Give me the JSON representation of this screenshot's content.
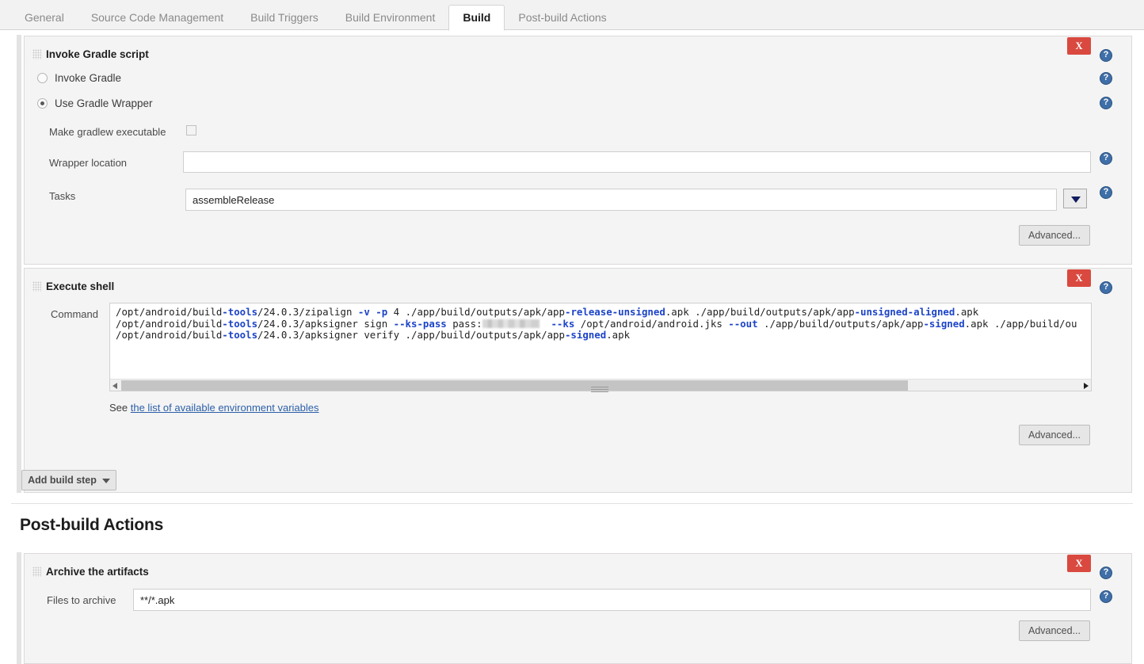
{
  "tabs": [
    {
      "label": "General",
      "active": false
    },
    {
      "label": "Source Code Management",
      "active": false
    },
    {
      "label": "Build Triggers",
      "active": false
    },
    {
      "label": "Build Environment",
      "active": false
    },
    {
      "label": "Build",
      "active": true
    },
    {
      "label": "Post-build Actions",
      "active": false
    }
  ],
  "colors": {
    "accent_blue": "#3f6fa8",
    "delete_red": "#d9493f",
    "link_blue": "#2b5fa8",
    "code_keyword": "#1d44c8",
    "panel_bg": "#f4f4f4",
    "page_bg": "#ffffff"
  },
  "icons": {
    "drag_grip": "drag-grip-icon",
    "help": "help-question-icon",
    "delete": "delete-x-icon",
    "dropdown_caret": "chevron-down-icon",
    "scroll_left": "scroll-arrow-left-icon",
    "scroll_right": "scroll-arrow-right-icon"
  },
  "gradle_step": {
    "title": "Invoke Gradle script",
    "delete_label": "X",
    "radios": [
      {
        "label": "Invoke Gradle",
        "checked": false
      },
      {
        "label": "Use Gradle Wrapper",
        "checked": true
      }
    ],
    "make_executable_label": "Make gradlew executable",
    "make_executable_checked": false,
    "wrapper_location_label": "Wrapper location",
    "wrapper_location_value": "",
    "tasks_label": "Tasks",
    "tasks_value": "assembleRelease",
    "advanced_label": "Advanced..."
  },
  "shell_step": {
    "title": "Execute shell",
    "delete_label": "X",
    "command_label": "Command",
    "command_lines": [
      [
        {
          "t": "/opt/android/build",
          "k": false
        },
        {
          "t": "-tools",
          "k": true
        },
        {
          "t": "/24.0.3/zipalign ",
          "k": false
        },
        {
          "t": "-v",
          "k": true
        },
        {
          "t": " ",
          "k": false
        },
        {
          "t": "-p",
          "k": true
        },
        {
          "t": " 4 ./app/build/outputs/apk/app",
          "k": false
        },
        {
          "t": "-release-unsigned",
          "k": true
        },
        {
          "t": ".apk ./app/build/outputs/apk/app",
          "k": false
        },
        {
          "t": "-unsigned-aligned",
          "k": true
        },
        {
          "t": ".apk",
          "k": false
        }
      ],
      [
        {
          "t": "/opt/android/build",
          "k": false
        },
        {
          "t": "-tools",
          "k": true
        },
        {
          "t": "/24.0.3/apksigner sign ",
          "k": false
        },
        {
          "t": "--ks-pass",
          "k": true
        },
        {
          "t": " pass:",
          "k": false
        },
        {
          "t": "[REDACTED]",
          "k": false,
          "redact": true
        },
        {
          "t": "  ",
          "k": false
        },
        {
          "t": "--ks",
          "k": true
        },
        {
          "t": " /opt/android/android.jks ",
          "k": false
        },
        {
          "t": "--out",
          "k": true
        },
        {
          "t": " ./app/build/outputs/apk/app",
          "k": false
        },
        {
          "t": "-signed",
          "k": true
        },
        {
          "t": ".apk ./app/build/ou",
          "k": false
        }
      ],
      [
        {
          "t": "/opt/android/build",
          "k": false
        },
        {
          "t": "-tools",
          "k": true
        },
        {
          "t": "/24.0.3/apksigner verify ./app/build/outputs/apk/app",
          "k": false
        },
        {
          "t": "-signed",
          "k": true
        },
        {
          "t": ".apk",
          "k": false
        }
      ]
    ],
    "see_prefix": "See ",
    "see_link": "the list of available environment variables",
    "advanced_label": "Advanced..."
  },
  "add_build_step_label": "Add build step",
  "post_build": {
    "heading": "Post-build Actions",
    "archive_step": {
      "title": "Archive the artifacts",
      "delete_label": "X",
      "files_label": "Files to archive",
      "files_value": "**/*.apk",
      "advanced_label": "Advanced..."
    }
  }
}
